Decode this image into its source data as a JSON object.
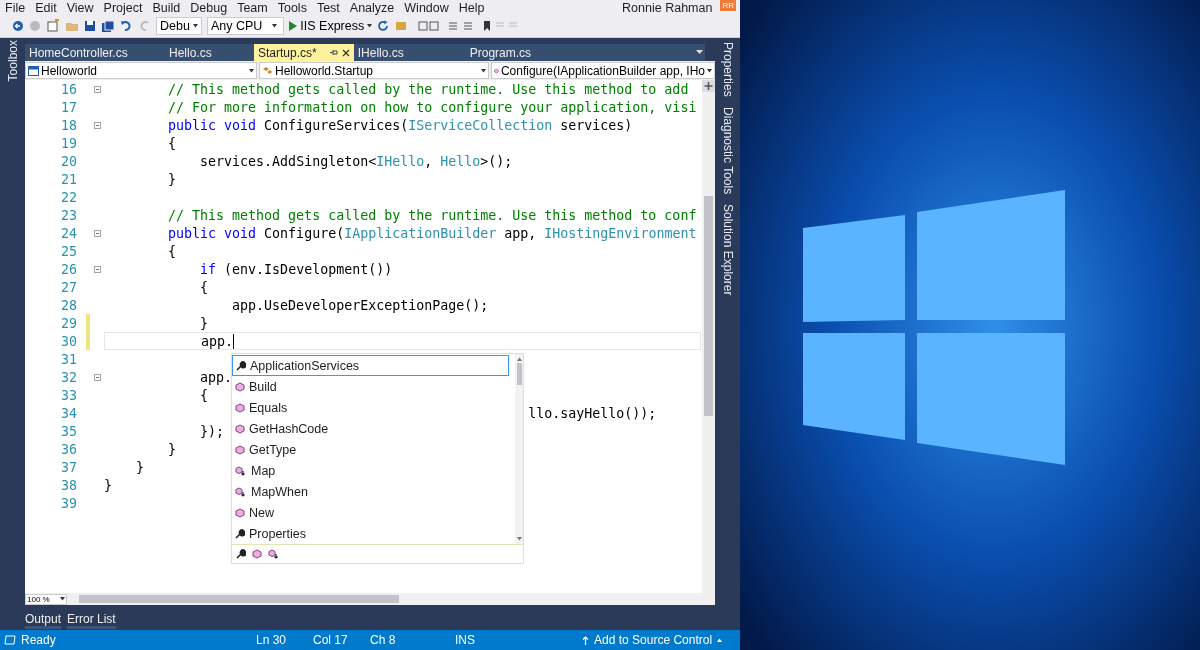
{
  "menu": [
    "File",
    "Edit",
    "View",
    "Project",
    "Build",
    "Debug",
    "Team",
    "Tools",
    "Test",
    "Analyze",
    "Window",
    "Help"
  ],
  "user": {
    "name": "Ronnie Rahman",
    "initials": "RR"
  },
  "toolbar": {
    "configuration": "Debu",
    "platform": "Any CPU",
    "run_target": "IIS Express"
  },
  "left_tabs": [
    "Toolbox"
  ],
  "doc_tabs": [
    {
      "label": "HomeController.cs",
      "selected": false
    },
    {
      "label": "Hello.cs",
      "selected": false
    },
    {
      "label": "Startup.cs*",
      "selected": true
    },
    {
      "label": "IHello.cs",
      "selected": false
    },
    {
      "label": "Program.cs",
      "selected": false
    }
  ],
  "nav_bar": [
    {
      "label": "Helloworld",
      "kind": "project"
    },
    {
      "label": "Helloworld.Startup",
      "kind": "class"
    },
    {
      "label": "Configure(IApplicationBuilder app, IHo",
      "kind": "method"
    }
  ],
  "editor": {
    "zoom": "100 %",
    "lines": [
      {
        "number": "16",
        "fold": true,
        "changed": false,
        "current": false,
        "tokens": [
          {
            "t": "        // This method gets called by the runtime. Use this method to add",
            "kind": "comment"
          }
        ]
      },
      {
        "number": "17",
        "fold": false,
        "changed": false,
        "current": false,
        "tokens": [
          {
            "t": "        // For more information on how to configure your application, visi",
            "kind": "comment"
          }
        ]
      },
      {
        "number": "18",
        "fold": true,
        "changed": false,
        "current": false,
        "tokens": [
          {
            "t": "        public void",
            "kind": "keyword"
          },
          {
            "t": " ConfigureServices(",
            "kind": "plain"
          },
          {
            "t": "IServiceCollection",
            "kind": "type"
          },
          {
            "t": " services)",
            "kind": "plain"
          }
        ]
      },
      {
        "number": "19",
        "fold": false,
        "changed": false,
        "current": false,
        "tokens": [
          {
            "t": "        {",
            "kind": "plain"
          }
        ]
      },
      {
        "number": "20",
        "fold": false,
        "changed": false,
        "current": false,
        "tokens": [
          {
            "t": "            services.AddSingleton<",
            "kind": "plain"
          },
          {
            "t": "IHello",
            "kind": "type"
          },
          {
            "t": ", ",
            "kind": "plain"
          },
          {
            "t": "Hello",
            "kind": "type"
          },
          {
            "t": ">();",
            "kind": "plain"
          }
        ]
      },
      {
        "number": "21",
        "fold": false,
        "changed": false,
        "current": false,
        "tokens": [
          {
            "t": "        }",
            "kind": "plain"
          }
        ]
      },
      {
        "number": "22",
        "fold": false,
        "changed": false,
        "current": false
      },
      {
        "number": "23",
        "fold": false,
        "changed": false,
        "current": false,
        "tokens": [
          {
            "t": "        // This method gets called by the runtime. Use this method to conf",
            "kind": "comment"
          }
        ]
      },
      {
        "number": "24",
        "fold": true,
        "changed": false,
        "current": false,
        "tokens": [
          {
            "t": "        public void",
            "kind": "keyword"
          },
          {
            "t": " Configure(",
            "kind": "plain"
          },
          {
            "t": "IApplicationBuilder",
            "kind": "type"
          },
          {
            "t": " app, ",
            "kind": "plain"
          },
          {
            "t": "IHostingEnvironment",
            "kind": "type"
          }
        ]
      },
      {
        "number": "25",
        "fold": false,
        "changed": false,
        "current": false,
        "tokens": [
          {
            "t": "        {",
            "kind": "plain"
          }
        ]
      },
      {
        "number": "26",
        "fold": true,
        "changed": false,
        "current": false,
        "tokens": [
          {
            "t": "            if",
            "kind": "keyword"
          },
          {
            "t": " (env.IsDevelopment())",
            "kind": "plain"
          }
        ]
      },
      {
        "number": "27",
        "fold": false,
        "changed": false,
        "current": false,
        "tokens": [
          {
            "t": "            {",
            "kind": "plain"
          }
        ]
      },
      {
        "number": "28",
        "fold": false,
        "changed": false,
        "current": false,
        "tokens": [
          {
            "t": "                app.UseDeveloperExceptionPage();",
            "kind": "plain"
          }
        ]
      },
      {
        "number": "29",
        "fold": false,
        "changed": true,
        "current": false,
        "tokens": [
          {
            "t": "            }",
            "kind": "plain"
          }
        ]
      },
      {
        "number": "30",
        "fold": false,
        "changed": true,
        "current": true,
        "tokens": [
          {
            "t": "            app.",
            "kind": "plain"
          }
        ]
      },
      {
        "number": "31",
        "fold": false,
        "changed": false,
        "current": false
      },
      {
        "number": "32",
        "fold": true,
        "changed": false,
        "current": false,
        "tokens": [
          {
            "t": "            app.",
            "kind": "plain"
          }
        ]
      },
      {
        "number": "33",
        "fold": false,
        "changed": false,
        "current": false,
        "tokens": [
          {
            "t": "            {",
            "kind": "plain"
          }
        ]
      },
      {
        "number": "34",
        "fold": false,
        "changed": false,
        "current": false,
        "tokens": [
          {
            "t": "                                                     llo.sayHello());",
            "kind": "plain"
          }
        ]
      },
      {
        "number": "35",
        "fold": false,
        "changed": false,
        "current": false,
        "tokens": [
          {
            "t": "            });",
            "kind": "plain"
          }
        ]
      },
      {
        "number": "36",
        "fold": false,
        "changed": false,
        "current": false,
        "tokens": [
          {
            "t": "        }",
            "kind": "plain"
          }
        ]
      },
      {
        "number": "37",
        "fold": false,
        "changed": false,
        "current": false,
        "tokens": [
          {
            "t": "    }",
            "kind": "plain"
          }
        ]
      },
      {
        "number": "38",
        "fold": false,
        "changed": false,
        "current": false,
        "tokens": [
          {
            "t": "}",
            "kind": "plain"
          }
        ]
      },
      {
        "number": "39",
        "fold": false,
        "changed": false,
        "current": false
      }
    ]
  },
  "completion": {
    "items": [
      {
        "label": "ApplicationServices",
        "kind": "property",
        "selected": true
      },
      {
        "label": "Build",
        "kind": "method",
        "selected": false
      },
      {
        "label": "Equals",
        "kind": "method",
        "selected": false
      },
      {
        "label": "GetHashCode",
        "kind": "method",
        "selected": false
      },
      {
        "label": "GetType",
        "kind": "method",
        "selected": false
      },
      {
        "label": "Map",
        "kind": "extension",
        "selected": false
      },
      {
        "label": "MapWhen",
        "kind": "extension",
        "selected": false
      },
      {
        "label": "New",
        "kind": "method",
        "selected": false
      },
      {
        "label": "Properties",
        "kind": "property",
        "selected": false
      }
    ],
    "filters": [
      {
        "kind": "property"
      },
      {
        "kind": "method"
      },
      {
        "kind": "extension"
      }
    ]
  },
  "bottom_tabs": [
    "Output",
    "Error List"
  ],
  "right_tabs": [
    "Properties",
    "Diagnostic Tools",
    "Solution Explorer"
  ],
  "status_bar": {
    "state": "Ready",
    "line": "Ln 30",
    "column": "Col 17",
    "char": "Ch 8",
    "mode": "INS",
    "source_control": "Add to Source Control"
  }
}
